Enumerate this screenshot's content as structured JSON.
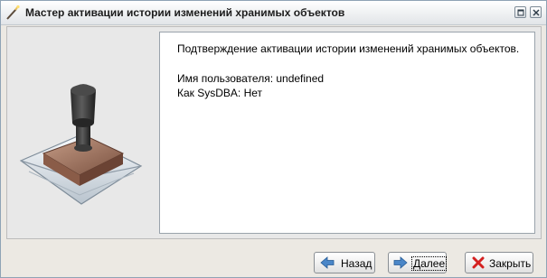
{
  "window": {
    "title": "Мастер активации истории изменений хранимых объектов"
  },
  "message": {
    "line1": "Подтверждение активации истории изменений хранимых объектов.",
    "line2": "Имя пользователя: undefined",
    "line3": "Как SysDBA: Нет"
  },
  "buttons": {
    "back": "Назад",
    "next": "Далее",
    "close": "Закрыть"
  },
  "icons": {
    "title": "wizard-wand-icon",
    "back": "arrow-left-icon",
    "next": "arrow-right-icon",
    "close": "red-x-icon",
    "illustration": "rubber-stamp-envelope-icon"
  }
}
